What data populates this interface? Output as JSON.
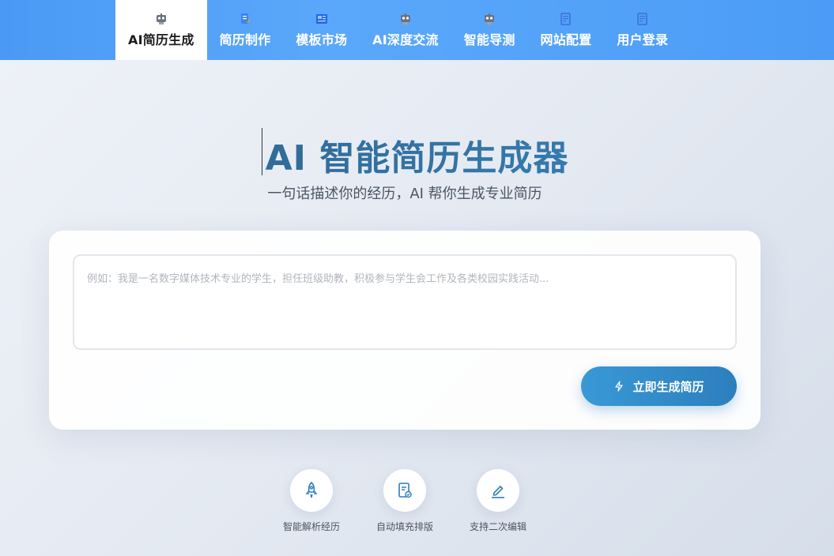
{
  "nav": {
    "items": [
      {
        "label": "AI简历生成",
        "icon": "robot-icon",
        "active": true
      },
      {
        "label": "简历制作",
        "icon": "edit-doc-icon",
        "active": false
      },
      {
        "label": "模板市场",
        "icon": "template-icon",
        "active": false
      },
      {
        "label": "AI深度交流",
        "icon": "robot-icon",
        "active": false
      },
      {
        "label": "智能导测",
        "icon": "robot-icon",
        "active": false
      },
      {
        "label": "网站配置",
        "icon": "config-doc-icon",
        "active": false
      },
      {
        "label": "用户登录",
        "icon": "login-doc-icon",
        "active": false
      }
    ]
  },
  "hero": {
    "title": "AI 智能简历生成器",
    "subtitle": "一句话描述你的经历，AI 帮你生成专业简历"
  },
  "prompt": {
    "placeholder": "例如：我是一名数字媒体技术专业的学生，担任班级助教，积极参与学生会工作及各类校园实践活动..."
  },
  "generate_button": {
    "label": "立即生成简历",
    "icon": "lightning-icon"
  },
  "features": [
    {
      "label": "智能解析经历",
      "icon": "rocket-icon"
    },
    {
      "label": "自动填充排版",
      "icon": "doc-check-icon"
    },
    {
      "label": "支持二次编辑",
      "icon": "pencil-icon"
    }
  ],
  "colors": {
    "nav_bg": "#4a9af5",
    "accent": "#2c7fbd",
    "title_gradient_start": "#2c5f86",
    "title_gradient_end": "#3a86c0"
  }
}
